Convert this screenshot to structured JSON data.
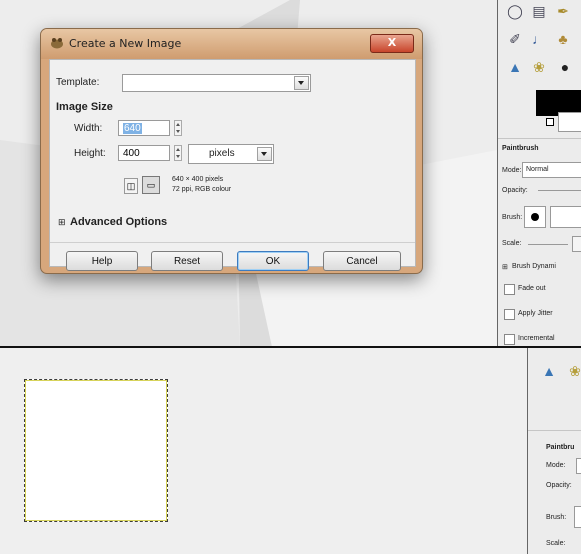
{
  "dialog": {
    "title": "Create a New Image",
    "close_label": "X",
    "template_label": "Template:",
    "template_value": "",
    "section_image_size": "Image Size",
    "width_label": "Width:",
    "width_value": "640",
    "height_label": "Height:",
    "height_value": "400",
    "unit_value": "pixels",
    "info_line1": "640 × 400 pixels",
    "info_line2": "72 ppi, RGB colour",
    "advanced_label": "Advanced Options",
    "buttons": {
      "help": "Help",
      "reset": "Reset",
      "ok": "OK",
      "cancel": "Cancel"
    }
  },
  "toolbox": {
    "tool_options_title": "Paintbrush",
    "mode_label": "Mode:",
    "mode_value": "Normal",
    "opacity_label": "Opacity:",
    "brush_label": "Brush:",
    "scale_label": "Scale:",
    "brush_dynamics_label": "Brush Dynami",
    "fade_out_label": "Fade out",
    "apply_jitter_label": "Apply Jitter",
    "incremental_label": "Incremental"
  },
  "bottom_toolbox": {
    "title": "Paintbru",
    "mode_label": "Mode:",
    "opacity_label": "Opacity:",
    "brush_label": "Brush:",
    "scale_label": "Scale:"
  },
  "icons": [
    "gimp-wilber-icon",
    "close-icon",
    "chain-icon",
    "landscape-icon",
    "expander-icon"
  ],
  "colors": {
    "dialog_frame": "#d7a77c",
    "close_button": "#c8452b",
    "default_button": "#3d7bbf",
    "selection_border": "#3b3b3b"
  }
}
